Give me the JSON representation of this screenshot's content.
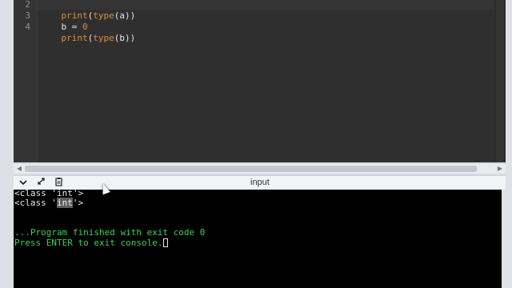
{
  "editor": {
    "lines": [
      {
        "num": "2",
        "parts": [
          {
            "t": "print",
            "c": "kw"
          },
          {
            "t": "(",
            "c": ""
          },
          {
            "t": "type",
            "c": "kw"
          },
          {
            "t": "(a))",
            "c": ""
          }
        ]
      },
      {
        "num": "3",
        "parts": [
          {
            "t": "b = ",
            "c": ""
          },
          {
            "t": "0",
            "c": "num"
          }
        ]
      },
      {
        "num": "4",
        "parts": [
          {
            "t": "print",
            "c": "kw"
          },
          {
            "t": "(",
            "c": ""
          },
          {
            "t": "type",
            "c": "kw"
          },
          {
            "t": "(b))",
            "c": ""
          }
        ]
      }
    ]
  },
  "console_toolbar": {
    "collapse_icon": "chevron-down-icon",
    "expand_icon": "expand-arrows-icon",
    "copy_icon": "clipboard-icon",
    "tab_label": "input"
  },
  "console": {
    "line1": "<class 'int'>",
    "line2_prefix": "<class '",
    "line2_highlight": "int",
    "line2_suffix": "'>",
    "finished": "...Program finished with exit code 0",
    "press_enter": "Press ENTER to exit console."
  },
  "colors": {
    "editor_bg": "#2f2f2f",
    "keyword": "#e28b3c",
    "console_green": "#39d353"
  }
}
